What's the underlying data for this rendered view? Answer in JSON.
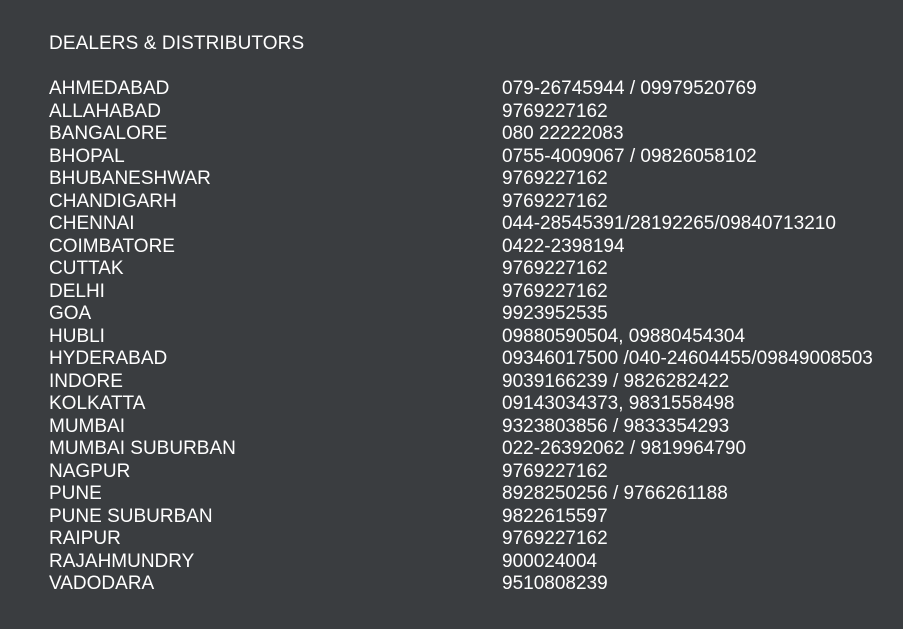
{
  "heading": "DEALERS & DISTRIBUTORS",
  "dealers": [
    {
      "city": "AHMEDABAD",
      "phone": "079-26745944 / 09979520769"
    },
    {
      "city": "ALLAHABAD",
      "phone": "9769227162"
    },
    {
      "city": "BANGALORE",
      "phone": "080 22222083"
    },
    {
      "city": "BHOPAL",
      "phone": "0755-4009067 / 09826058102"
    },
    {
      "city": "BHUBANESHWAR",
      "phone": "9769227162"
    },
    {
      "city": "CHANDIGARH",
      "phone": "9769227162"
    },
    {
      "city": "CHENNAI",
      "phone": "044-28545391/28192265/09840713210"
    },
    {
      "city": "COIMBATORE",
      "phone": "0422-2398194"
    },
    {
      "city": "CUTTAK",
      "phone": "9769227162"
    },
    {
      "city": "DELHI",
      "phone": "9769227162"
    },
    {
      "city": "GOA",
      "phone": "9923952535"
    },
    {
      "city": "HUBLI",
      "phone": "09880590504, 09880454304"
    },
    {
      "city": "HYDERABAD",
      "phone": "09346017500 /040-24604455/09849008503"
    },
    {
      "city": "INDORE",
      "phone": "9039166239 / 9826282422"
    },
    {
      "city": "KOLKATTA",
      "phone": "09143034373, 9831558498"
    },
    {
      "city": "MUMBAI",
      "phone": "9323803856 / 9833354293"
    },
    {
      "city": "MUMBAI SUBURBAN",
      "phone": "022-26392062 / 9819964790"
    },
    {
      "city": "NAGPUR",
      "phone": "9769227162"
    },
    {
      "city": "PUNE",
      "phone": "8928250256 / 9766261188"
    },
    {
      "city": "PUNE SUBURBAN",
      "phone": "9822615597"
    },
    {
      "city": "RAIPUR",
      "phone": "9769227162"
    },
    {
      "city": "RAJAHMUNDRY",
      "phone": "900024004"
    },
    {
      "city": "VADODARA",
      "phone": "9510808239"
    }
  ]
}
